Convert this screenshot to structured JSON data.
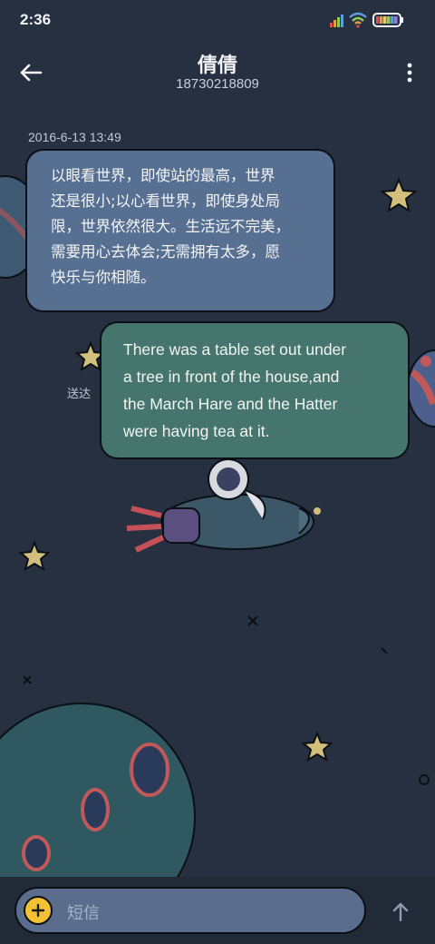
{
  "status_bar": {
    "time": "2:36",
    "icons": [
      "signal-icon",
      "wifi-icon",
      "battery-icon"
    ]
  },
  "header": {
    "contact_name": "倩倩",
    "contact_number": "18730218809",
    "back_icon": "back-arrow-icon",
    "menu_icon": "more-vert-icon"
  },
  "conversation": {
    "timestamp": "2016-6-13 13:49",
    "messages": [
      {
        "direction": "incoming",
        "lines": [
          "以眼看世界，即使站的最高，世界",
          "还是很小;以心看世界，即使身处局",
          "限，世界依然很大。生活远不完美，",
          "需要用心去体会;无需拥有太多，愿",
          "快乐与你相随。"
        ]
      },
      {
        "direction": "outgoing",
        "lines": [
          "There was a table set out under",
          "a tree in front of the house,and",
          "the March Hare and the Hatter",
          "were having tea at it."
        ],
        "status": "送达"
      }
    ]
  },
  "composer": {
    "placeholder": "短信",
    "add_icon": "plus-icon",
    "send_icon": "send-arrow-icon"
  },
  "colors": {
    "background": "#263040",
    "incoming_bubble": "#576f91",
    "outgoing_bubble": "#46756d",
    "input": "#5a6d8d",
    "add_button": "#f2c232"
  }
}
